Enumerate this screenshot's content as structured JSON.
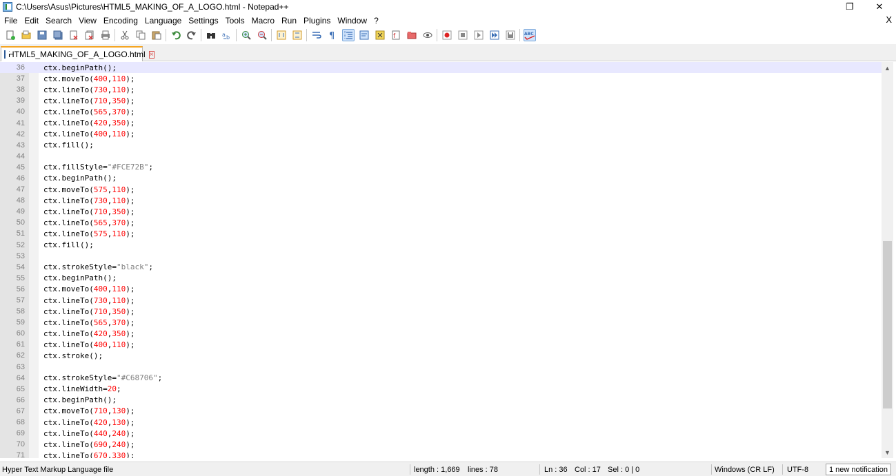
{
  "window": {
    "title": "C:\\Users\\Asus\\Pictures\\HTML5_MAKING_OF_A_LOGO.html - Notepad++",
    "restore_glyph": "❐",
    "close_glyph": "✕"
  },
  "menu": {
    "items": [
      "File",
      "Edit",
      "Search",
      "View",
      "Encoding",
      "Language",
      "Settings",
      "Tools",
      "Macro",
      "Run",
      "Plugins",
      "Window",
      "?"
    ],
    "close_doc_glyph": "X"
  },
  "toolbar": {
    "icons": [
      "new-file-icon",
      "open-file-icon",
      "save-icon",
      "save-all-icon",
      "close-icon",
      "close-all-icon",
      "print-icon",
      "cut-icon",
      "copy-icon",
      "paste-icon",
      "undo-icon",
      "redo-icon",
      "find-icon",
      "replace-icon",
      "zoom-in-icon",
      "zoom-out-icon",
      "sync-vertical-icon",
      "sync-horizontal-icon",
      "word-wrap-icon",
      "show-all-chars-icon",
      "indent-guide-icon",
      "user-defined-language-icon",
      "doc-map-icon",
      "function-list-icon",
      "folder-as-workspace-icon",
      "monitoring-icon",
      "record-macro-icon",
      "stop-macro-icon",
      "play-macro-icon",
      "run-macro-multiple-icon",
      "save-macro-icon",
      "spell-check-icon"
    ],
    "active": [
      "indent-guide-icon",
      "spell-check-icon"
    ]
  },
  "tab": {
    "label": "HTML5_MAKING_OF_A_LOGO.html",
    "close_glyph": "×"
  },
  "editor": {
    "current_line": 36,
    "lines": [
      {
        "n": "36",
        "parts": [
          [
            "p",
            "ctx.beginPath();"
          ]
        ]
      },
      {
        "n": "37",
        "parts": [
          [
            "p",
            "ctx.moveTo("
          ],
          [
            "num",
            "400"
          ],
          [
            "p",
            ","
          ],
          [
            "num",
            "110"
          ],
          [
            "p",
            ");"
          ]
        ]
      },
      {
        "n": "38",
        "parts": [
          [
            "p",
            "ctx.lineTo("
          ],
          [
            "num",
            "730"
          ],
          [
            "p",
            ","
          ],
          [
            "num",
            "110"
          ],
          [
            "p",
            ");"
          ]
        ]
      },
      {
        "n": "39",
        "parts": [
          [
            "p",
            "ctx.lineTo("
          ],
          [
            "num",
            "710"
          ],
          [
            "p",
            ","
          ],
          [
            "num",
            "350"
          ],
          [
            "p",
            ");"
          ]
        ]
      },
      {
        "n": "40",
        "parts": [
          [
            "p",
            "ctx.lineTo("
          ],
          [
            "num",
            "565"
          ],
          [
            "p",
            ","
          ],
          [
            "num",
            "370"
          ],
          [
            "p",
            ");"
          ]
        ]
      },
      {
        "n": "41",
        "parts": [
          [
            "p",
            "ctx.lineTo("
          ],
          [
            "num",
            "420"
          ],
          [
            "p",
            ","
          ],
          [
            "num",
            "350"
          ],
          [
            "p",
            ");"
          ]
        ]
      },
      {
        "n": "42",
        "parts": [
          [
            "p",
            "ctx.lineTo("
          ],
          [
            "num",
            "400"
          ],
          [
            "p",
            ","
          ],
          [
            "num",
            "110"
          ],
          [
            "p",
            ");"
          ]
        ]
      },
      {
        "n": "43",
        "parts": [
          [
            "p",
            "ctx.fill();"
          ]
        ]
      },
      {
        "n": "44",
        "parts": []
      },
      {
        "n": "45",
        "parts": [
          [
            "p",
            "ctx.fillStyle="
          ],
          [
            "str",
            "\"#FCE72B\""
          ],
          [
            "p",
            ";"
          ]
        ]
      },
      {
        "n": "46",
        "parts": [
          [
            "p",
            "ctx.beginPath();"
          ]
        ]
      },
      {
        "n": "47",
        "parts": [
          [
            "p",
            "ctx.moveTo("
          ],
          [
            "num",
            "575"
          ],
          [
            "p",
            ","
          ],
          [
            "num",
            "110"
          ],
          [
            "p",
            ");"
          ]
        ]
      },
      {
        "n": "48",
        "parts": [
          [
            "p",
            "ctx.lineTo("
          ],
          [
            "num",
            "730"
          ],
          [
            "p",
            ","
          ],
          [
            "num",
            "110"
          ],
          [
            "p",
            ");"
          ]
        ]
      },
      {
        "n": "49",
        "parts": [
          [
            "p",
            "ctx.lineTo("
          ],
          [
            "num",
            "710"
          ],
          [
            "p",
            ","
          ],
          [
            "num",
            "350"
          ],
          [
            "p",
            ");"
          ]
        ]
      },
      {
        "n": "50",
        "parts": [
          [
            "p",
            "ctx.lineTo("
          ],
          [
            "num",
            "565"
          ],
          [
            "p",
            ","
          ],
          [
            "num",
            "370"
          ],
          [
            "p",
            ");"
          ]
        ]
      },
      {
        "n": "51",
        "parts": [
          [
            "p",
            "ctx.lineTo("
          ],
          [
            "num",
            "575"
          ],
          [
            "p",
            ","
          ],
          [
            "num",
            "110"
          ],
          [
            "p",
            ");"
          ]
        ]
      },
      {
        "n": "52",
        "parts": [
          [
            "p",
            "ctx.fill();"
          ]
        ]
      },
      {
        "n": "53",
        "parts": []
      },
      {
        "n": "54",
        "parts": [
          [
            "p",
            "ctx.strokeStyle="
          ],
          [
            "str",
            "\"black\""
          ],
          [
            "p",
            ";"
          ]
        ]
      },
      {
        "n": "55",
        "parts": [
          [
            "p",
            "ctx.beginPath();"
          ]
        ]
      },
      {
        "n": "56",
        "parts": [
          [
            "p",
            "ctx.moveTo("
          ],
          [
            "num",
            "400"
          ],
          [
            "p",
            ","
          ],
          [
            "num",
            "110"
          ],
          [
            "p",
            ");"
          ]
        ]
      },
      {
        "n": "57",
        "parts": [
          [
            "p",
            "ctx.lineTo("
          ],
          [
            "num",
            "730"
          ],
          [
            "p",
            ","
          ],
          [
            "num",
            "110"
          ],
          [
            "p",
            ");"
          ]
        ]
      },
      {
        "n": "58",
        "parts": [
          [
            "p",
            "ctx.lineTo("
          ],
          [
            "num",
            "710"
          ],
          [
            "p",
            ","
          ],
          [
            "num",
            "350"
          ],
          [
            "p",
            ");"
          ]
        ]
      },
      {
        "n": "59",
        "parts": [
          [
            "p",
            "ctx.lineTo("
          ],
          [
            "num",
            "565"
          ],
          [
            "p",
            ","
          ],
          [
            "num",
            "370"
          ],
          [
            "p",
            ");"
          ]
        ]
      },
      {
        "n": "60",
        "parts": [
          [
            "p",
            "ctx.lineTo("
          ],
          [
            "num",
            "420"
          ],
          [
            "p",
            ","
          ],
          [
            "num",
            "350"
          ],
          [
            "p",
            ");"
          ]
        ]
      },
      {
        "n": "61",
        "parts": [
          [
            "p",
            "ctx.lineTo("
          ],
          [
            "num",
            "400"
          ],
          [
            "p",
            ","
          ],
          [
            "num",
            "110"
          ],
          [
            "p",
            ");"
          ]
        ]
      },
      {
        "n": "62",
        "parts": [
          [
            "p",
            "ctx.stroke();"
          ]
        ]
      },
      {
        "n": "63",
        "parts": []
      },
      {
        "n": "64",
        "parts": [
          [
            "p",
            "ctx.strokeStyle="
          ],
          [
            "str",
            "\"#C68706\""
          ],
          [
            "p",
            ";"
          ]
        ]
      },
      {
        "n": "65",
        "parts": [
          [
            "p",
            "ctx.lineWidth="
          ],
          [
            "num",
            "20"
          ],
          [
            "p",
            ";"
          ]
        ]
      },
      {
        "n": "66",
        "parts": [
          [
            "p",
            "ctx.beginPath();"
          ]
        ]
      },
      {
        "n": "67",
        "parts": [
          [
            "p",
            "ctx.moveTo("
          ],
          [
            "num",
            "710"
          ],
          [
            "p",
            ","
          ],
          [
            "num",
            "130"
          ],
          [
            "p",
            ");"
          ]
        ]
      },
      {
        "n": "68",
        "parts": [
          [
            "p",
            "ctx.lineTo("
          ],
          [
            "num",
            "420"
          ],
          [
            "p",
            ","
          ],
          [
            "num",
            "130"
          ],
          [
            "p",
            ");"
          ]
        ]
      },
      {
        "n": "69",
        "parts": [
          [
            "p",
            "ctx.lineTo("
          ],
          [
            "num",
            "440"
          ],
          [
            "p",
            ","
          ],
          [
            "num",
            "240"
          ],
          [
            "p",
            ");"
          ]
        ]
      },
      {
        "n": "70",
        "parts": [
          [
            "p",
            "ctx.lineTo("
          ],
          [
            "num",
            "690"
          ],
          [
            "p",
            ","
          ],
          [
            "num",
            "240"
          ],
          [
            "p",
            ");"
          ]
        ]
      },
      {
        "n": "71",
        "parts": [
          [
            "p",
            "ctx.lineTo("
          ],
          [
            "num",
            "670"
          ],
          [
            "p",
            ","
          ],
          [
            "num",
            "330"
          ],
          [
            "p",
            ");"
          ]
        ]
      }
    ]
  },
  "status": {
    "file_type": "Hyper Text Markup Language file",
    "length": "length : 1,669",
    "lines": "lines : 78",
    "ln": "Ln : 36",
    "col": "Col : 17",
    "sel": "Sel : 0 | 0",
    "eol": "Windows (CR LF)",
    "encoding": "UTF-8",
    "notification": "1 new notification"
  },
  "colors": {
    "number": "#ff0000",
    "string": "#808080",
    "current_line_bg": "#e8e8ff",
    "tab_accent": "#f5a623"
  }
}
